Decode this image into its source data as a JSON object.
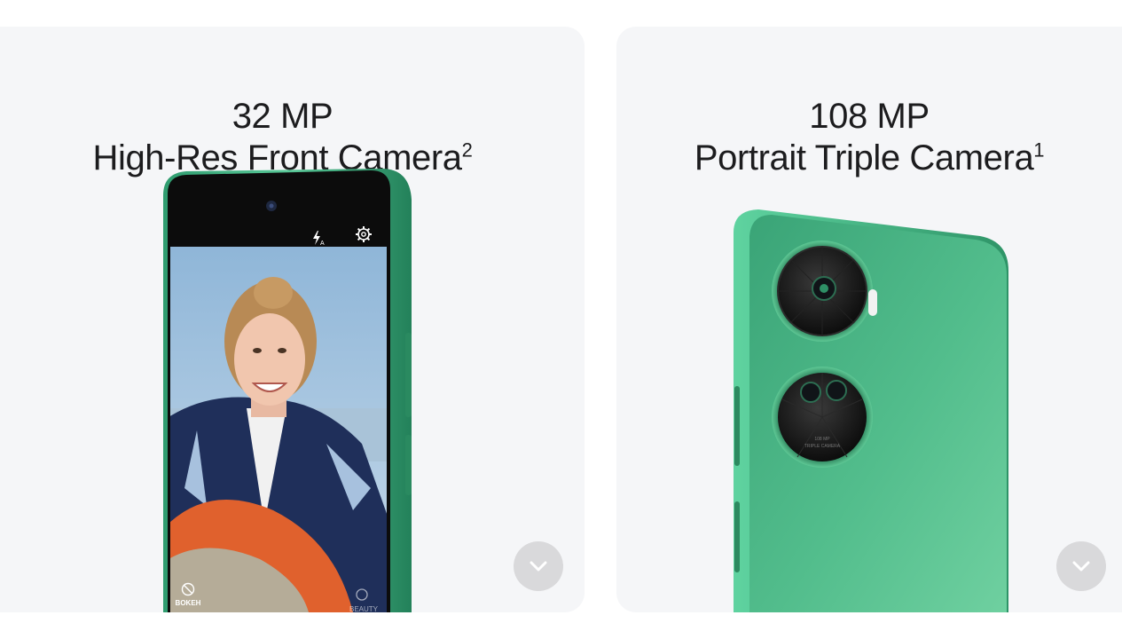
{
  "cards": [
    {
      "title_line1": "32 MP",
      "title_line2": "High-Res Front Camera",
      "footnote": "2",
      "camera_ui": {
        "mode_left": "BOKEH",
        "mode_right": "BEAUTY"
      },
      "expand_icon": "chevron-down-icon"
    },
    {
      "title_line1": "108 MP",
      "title_line2": "Portrait Triple Camera",
      "footnote": "1",
      "lens_engraving": [
        "108 MP",
        "TRIPLE CAMERA"
      ],
      "expand_icon": "chevron-down-icon"
    }
  ],
  "colors": {
    "card_bg": "#f5f6f8",
    "phone_green": "#3fae80",
    "button_bg": "#d9d9db"
  }
}
